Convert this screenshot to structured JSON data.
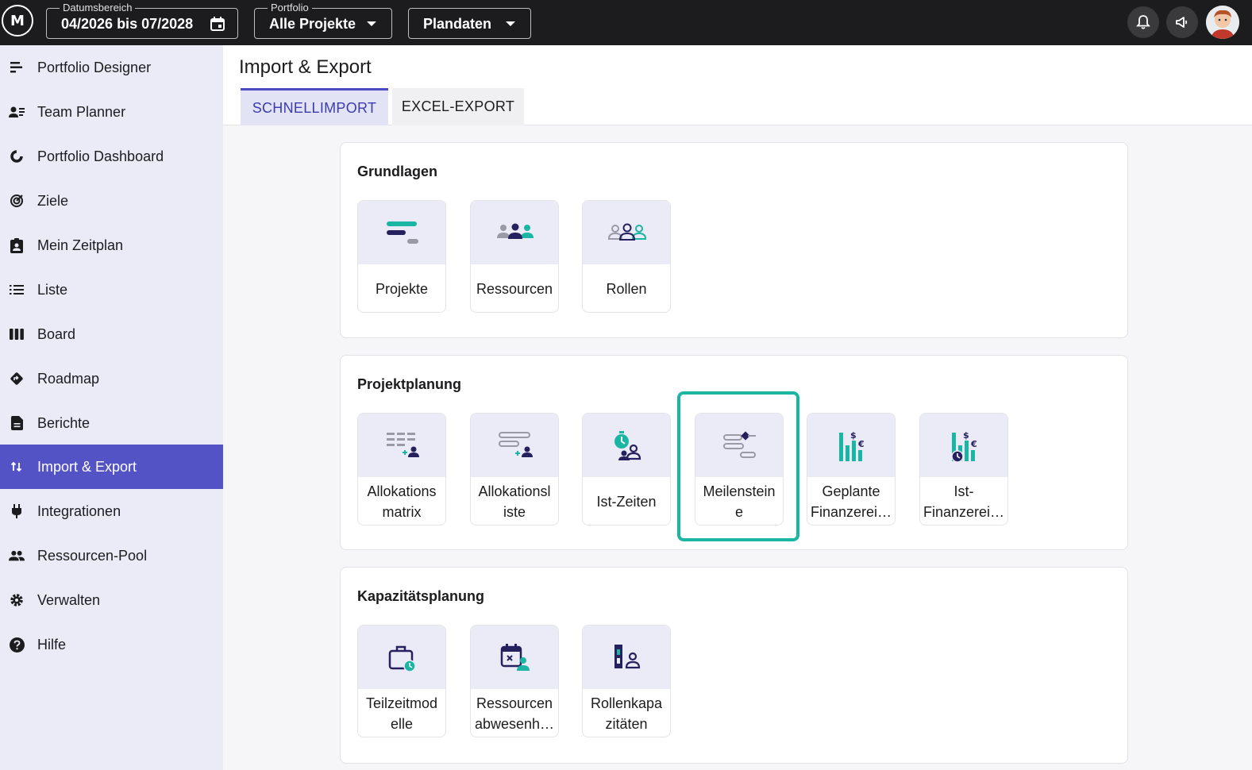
{
  "topbar": {
    "logo_text": "M",
    "date_range": {
      "legend": "Datumsbereich",
      "value": "04/2026 bis 07/2028"
    },
    "portfolio": {
      "legend": "Portfolio",
      "value": "Alle Projekte"
    },
    "data_mode": {
      "value": "Plandaten"
    }
  },
  "sidebar": {
    "items": [
      {
        "label": "Portfolio Designer",
        "icon": "portfolio-designer-icon"
      },
      {
        "label": "Team Planner",
        "icon": "team-planner-icon"
      },
      {
        "label": "Portfolio Dashboard",
        "icon": "dashboard-icon"
      },
      {
        "label": "Ziele",
        "icon": "target-icon"
      },
      {
        "label": "Mein Zeitplan",
        "icon": "schedule-icon"
      },
      {
        "label": "Liste",
        "icon": "list-icon"
      },
      {
        "label": "Board",
        "icon": "board-icon"
      },
      {
        "label": "Roadmap",
        "icon": "roadmap-icon"
      },
      {
        "label": "Berichte",
        "icon": "report-icon"
      },
      {
        "label": "Import & Export",
        "icon": "import-export-icon",
        "active": true
      },
      {
        "label": "Integrationen",
        "icon": "plug-icon"
      },
      {
        "label": "Ressourcen-Pool",
        "icon": "people-icon"
      },
      {
        "label": "Verwalten",
        "icon": "gear-icon"
      },
      {
        "label": "Hilfe",
        "icon": "help-icon"
      }
    ]
  },
  "page": {
    "title": "Import & Export",
    "tabs": [
      {
        "label": "SCHNELLIMPORT",
        "active": true
      },
      {
        "label": "EXCEL-EXPORT",
        "active": false
      }
    ]
  },
  "sections": [
    {
      "title": "Grundlagen",
      "tiles": [
        {
          "label": "Projekte",
          "icon": "projects-icon"
        },
        {
          "label": "Ressourcen",
          "icon": "resources-icon"
        },
        {
          "label": "Rollen",
          "icon": "roles-icon"
        }
      ]
    },
    {
      "title": "Projektplanung",
      "tiles": [
        {
          "line1": "Allokations",
          "line2": "matrix",
          "icon": "allocation-matrix-icon"
        },
        {
          "line1": "Allokationsl",
          "line2": "iste",
          "icon": "allocation-list-icon"
        },
        {
          "label": "Ist-Zeiten",
          "icon": "actual-times-icon"
        },
        {
          "line1": "Meilenstein",
          "line2": "e",
          "icon": "milestones-icon",
          "highlighted": true
        },
        {
          "line1": "Geplante",
          "line2": "Finanzerei…",
          "icon": "planned-finance-icon"
        },
        {
          "line1": "Ist-",
          "line2": "Finanzerei…",
          "icon": "actual-finance-icon"
        }
      ]
    },
    {
      "title": "Kapazitätsplanung",
      "tiles": [
        {
          "line1": "Teilzeitmod",
          "line2": "elle",
          "icon": "part-time-icon"
        },
        {
          "line1": "Ressourcen",
          "line2": "abwesenh…",
          "icon": "absence-icon"
        },
        {
          "line1": "Rollenkapa",
          "line2": "zitäten",
          "icon": "role-capacity-icon"
        }
      ]
    }
  ],
  "colors": {
    "accent": "#5453c6",
    "teal": "#1ab5a3",
    "navy": "#25215e",
    "topbar": "#1c1c1e",
    "sidebar_bg": "#ebebf7"
  }
}
